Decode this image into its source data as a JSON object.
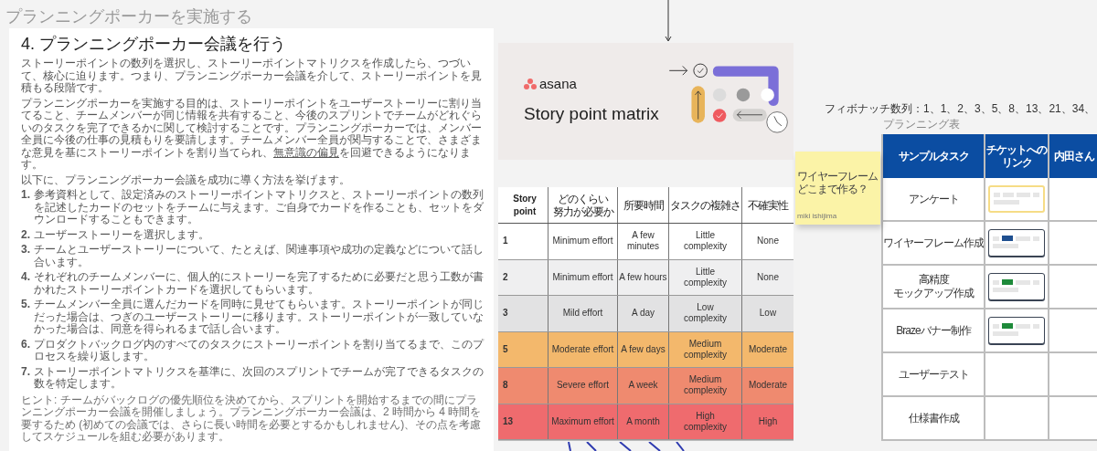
{
  "canvas_title": "プランニングポーカーを実施する",
  "article": {
    "heading": "4. プランニングポーカー会議を行う",
    "paragraphs": [
      {
        "text": "ストーリーポイントの数列を選択し、ストーリーポイントマトリクスを作成したら、つづいて、核心に迫ります。つまり、プランニングポーカー会議を介して、ストーリーポイントを見積もる段階です。"
      },
      {
        "text": "プランニングポーカーを実施する目的は、ストーリーポイントをユーザーストーリーに割り当てること、チームメンバーが同じ情報を共有すること、今後のスプリントでチームがどれぐらいのタスクを完了できるかに関して検討することです。プランニングポーカーでは、メンバー全員に今後の仕事の見積もりを要請します。チームメンバー全員が関与することで、さまざまな意見を基にストーリーポイントを割り当てられ、",
        "link": "無意識の偏見",
        "after": "を回避できるようになります。"
      },
      {
        "text": "以下に、プランニングポーカー会議を成功に導く方法を挙げます。"
      }
    ],
    "steps": [
      {
        "number": "1.",
        "text": "参考資料として、設定済みのストーリーポイントマトリクスと、ストーリーポイントの数列を記述したカードのセットをチームに与えます。ご自身でカードを作ることも、セットをダウンロードすることもできます。"
      },
      {
        "number": "2.",
        "text": "ユーザーストーリーを選択します。"
      },
      {
        "number": "3.",
        "text": "チームとユーザーストーリーについて、たとえば、関連事項や成功の定義などについて話し合います。"
      },
      {
        "number": "4.",
        "text": "それぞれのチームメンバーに、個人的にストーリーを完了するために必要だと思う工数が書かれたストーリーポイントカードを選択してもらいます。"
      },
      {
        "number": "5.",
        "text": "チームメンバー全員に選んだカードを同時に見せてもらいます。ストーリーポイントが同じだった場合は、つぎのユーザーストーリーに移ります。ストーリーポイントが一致していなかった場合は、同意を得られるまで話し合います。"
      },
      {
        "number": "6.",
        "text": "プロダクトバックログ内のすべてのタスクにストーリーポイントを割り当てるまで、このプロセスを繰り返します。"
      },
      {
        "number": "7.",
        "text": "ストーリーポイントマトリクスを基準に、次回のスプリントでチームが完了できるタスクの数を特定します。"
      }
    ],
    "hint": "ヒント: チームがバックログの優先順位を決めてから、スプリントを開始するまでの間にプランニングポーカー会議を開催しましょう。プランニングポーカー会議は、2 時間から 4 時間を要するため (初めての会議では、さらに長い時間を必要とするかもしれません)、その点を考慮してスケジュールを組む必要があります。"
  },
  "banner": {
    "logo_text": "asana",
    "title": "Story point matrix"
  },
  "story_point_matrix": {
    "columns": [
      {
        "lines": [
          "Story point"
        ]
      },
      {
        "lines": [
          "どのくらい",
          "努力が必要か"
        ]
      },
      {
        "lines": [
          "所要時間"
        ]
      },
      {
        "lines": [
          "タスクの複雑さ"
        ]
      },
      {
        "lines": [
          "不確実性"
        ]
      }
    ],
    "rows": [
      {
        "point": "1",
        "effort": "Minimum effort",
        "time": "A few minutes",
        "complexity": "Little complexity",
        "uncertainty": "None",
        "color": "#ffffff"
      },
      {
        "point": "2",
        "effort": "Minimum effort",
        "time": "A few hours",
        "complexity": "Little complexity",
        "uncertainty": "None",
        "color": "#efeff0"
      },
      {
        "point": "3",
        "effort": "Mild effort",
        "time": "A day",
        "complexity": "Low complexity",
        "uncertainty": "Low",
        "color": "#e2e2e3"
      },
      {
        "point": "5",
        "effort": "Moderate effort",
        "time": "A few days",
        "complexity": "Medium complexity",
        "uncertainty": "Moderate",
        "color": "#f3b86c"
      },
      {
        "point": "8",
        "effort": "Severe effort",
        "time": "A week",
        "complexity": "Medium complexity",
        "uncertainty": "Moderate",
        "color": "#ef8a6f"
      },
      {
        "point": "13",
        "effort": "Maximum effort",
        "time": "A month",
        "complexity": "High complexity",
        "uncertainty": "High",
        "color": "#ef6b6e"
      }
    ]
  },
  "sticky_note": {
    "lines": [
      "ワイヤーフレーム",
      "どこまで作る？"
    ],
    "author": "miki ishijima"
  },
  "fibonacci_note": "フィボナッチ数列：1、1、2、3、5、8、13、21、34、",
  "planning_table": {
    "label": "プランニング表",
    "columns": [
      "サンプルタスク",
      "チケットへのリンク",
      "内田さん"
    ],
    "rows": [
      {
        "task": [
          "アンケート"
        ],
        "ticket": {
          "selected": true
        }
      },
      {
        "task": [
          "ワイヤーフレーム作成"
        ],
        "ticket": {
          "selected": false,
          "color": "#1f4f8f"
        }
      },
      {
        "task": [
          "高精度",
          "モックアップ作成"
        ],
        "ticket": {
          "selected": false,
          "color": "#1e8a3a"
        }
      },
      {
        "task": [
          "Brazeバナー制作"
        ],
        "ticket": {
          "selected": false,
          "color": "#1e8a3a"
        }
      },
      {
        "task": [
          "ユーザーテスト"
        ]
      },
      {
        "task": [
          "仕様書作成"
        ]
      }
    ]
  }
}
